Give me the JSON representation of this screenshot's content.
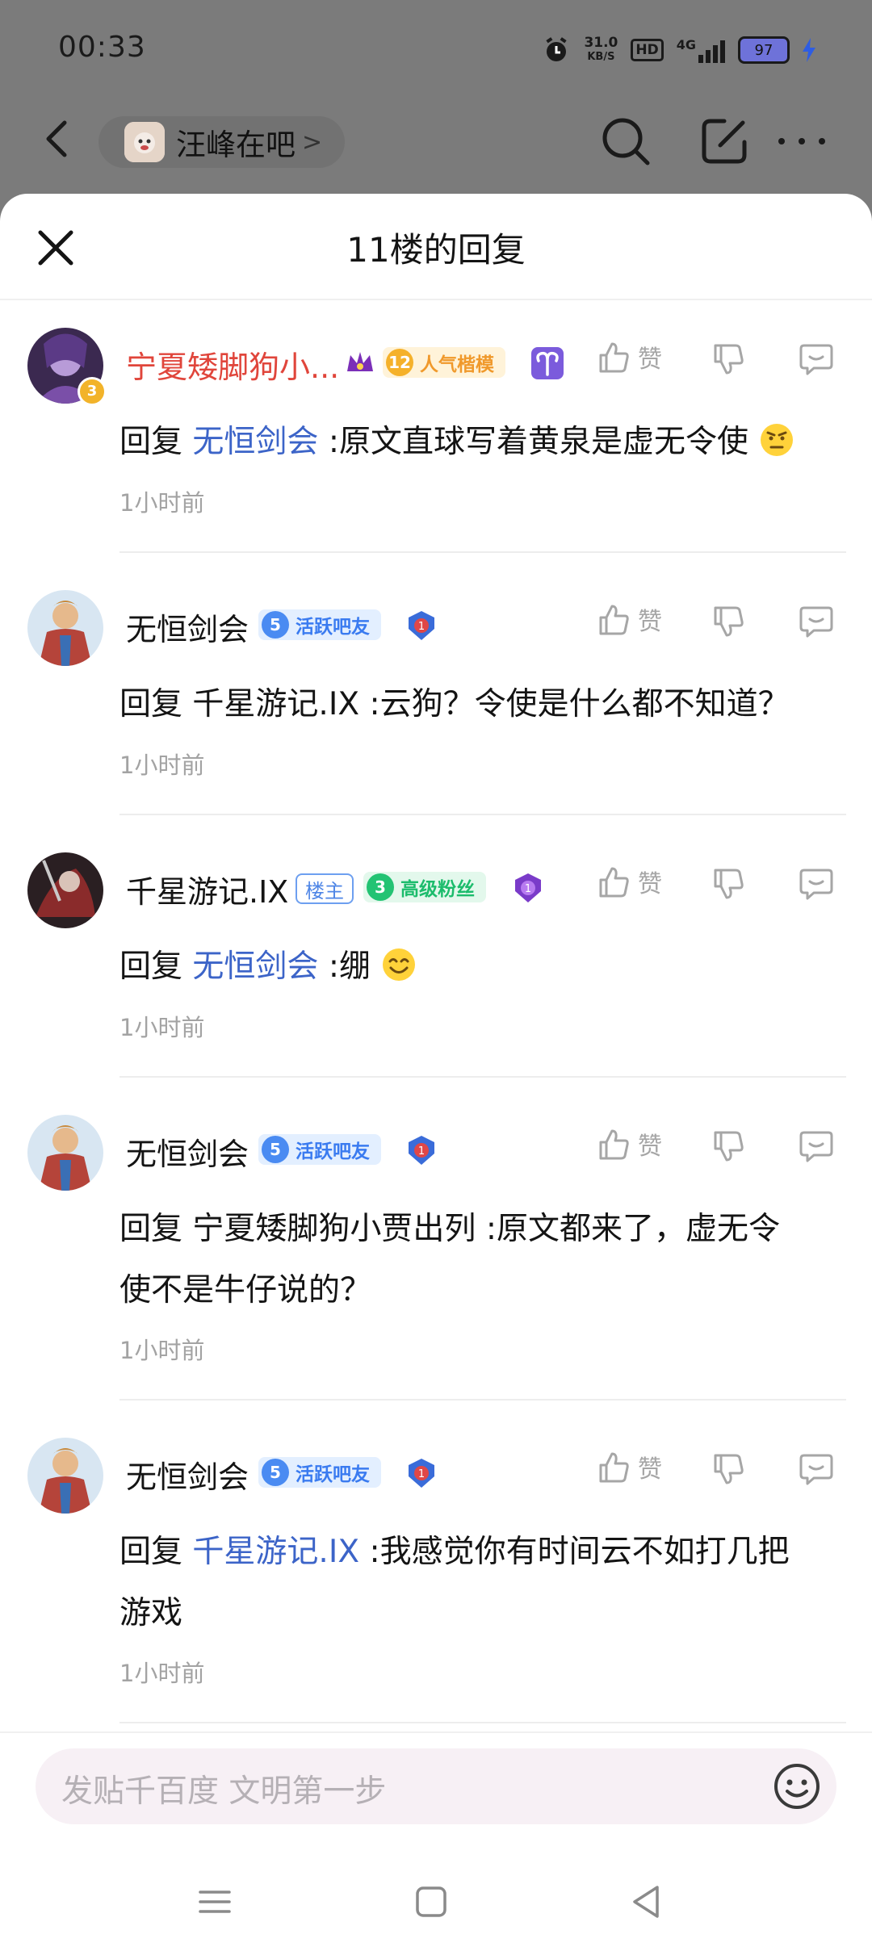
{
  "status_bar": {
    "time": "00:33",
    "net_speed": "31.0",
    "net_unit": "KB/S",
    "hd": "HD",
    "network": "4G",
    "battery": "97"
  },
  "top_bar": {
    "forum_name": "汪峰在吧",
    "forum_arrow": ">"
  },
  "sheet": {
    "title": "11楼的回复"
  },
  "replies": [
    {
      "user": "宁夏矮脚狗小...",
      "avatar_level": "3",
      "badges": {
        "pop_level": "12",
        "pop_label": "人气楷模"
      },
      "reply_prefix": "回复",
      "reply_to": "无恒剑会",
      "text": ":原文直球写着黄泉是虚无令使",
      "time": "1小时前",
      "like": "赞"
    },
    {
      "user": "无恒剑会",
      "badges": {
        "level": "5",
        "label": "活跃吧友"
      },
      "reply_prefix": "回复",
      "reply_to": "千星游记.IX",
      "text": ":云狗？令使是什么都不知道？",
      "time": "1小时前",
      "like": "赞"
    },
    {
      "user": "千星游记.IX",
      "badges": {
        "host": "楼主",
        "level": "3",
        "label": "高级粉丝"
      },
      "reply_prefix": "回复",
      "reply_to": "无恒剑会",
      "text": ":绷",
      "time": "1小时前",
      "like": "赞"
    },
    {
      "user": "无恒剑会",
      "badges": {
        "level": "5",
        "label": "活跃吧友"
      },
      "reply_prefix": "回复",
      "reply_to": "宁夏矮脚狗小贾出列",
      "text_line1": ":原文都来了，虚无令",
      "text_line2": "使不是牛仔说的？",
      "time": "1小时前",
      "like": "赞"
    },
    {
      "user": "无恒剑会",
      "badges": {
        "level": "5",
        "label": "活跃吧友"
      },
      "reply_prefix": "回复",
      "reply_to": "千星游记.IX",
      "text_line1": ":我感觉你有时间云不如打几把",
      "text_line2": "游戏",
      "time": "1小时前",
      "like": "赞"
    }
  ],
  "input": {
    "placeholder": "发贴千百度 文明第一步"
  },
  "colors": {
    "accent_blue": "#3c64c8",
    "vip_red": "#e0453b",
    "active_blue": "#3a7bf0",
    "fans_green": "#1cbc6c",
    "pop_orange": "#f0992b"
  }
}
